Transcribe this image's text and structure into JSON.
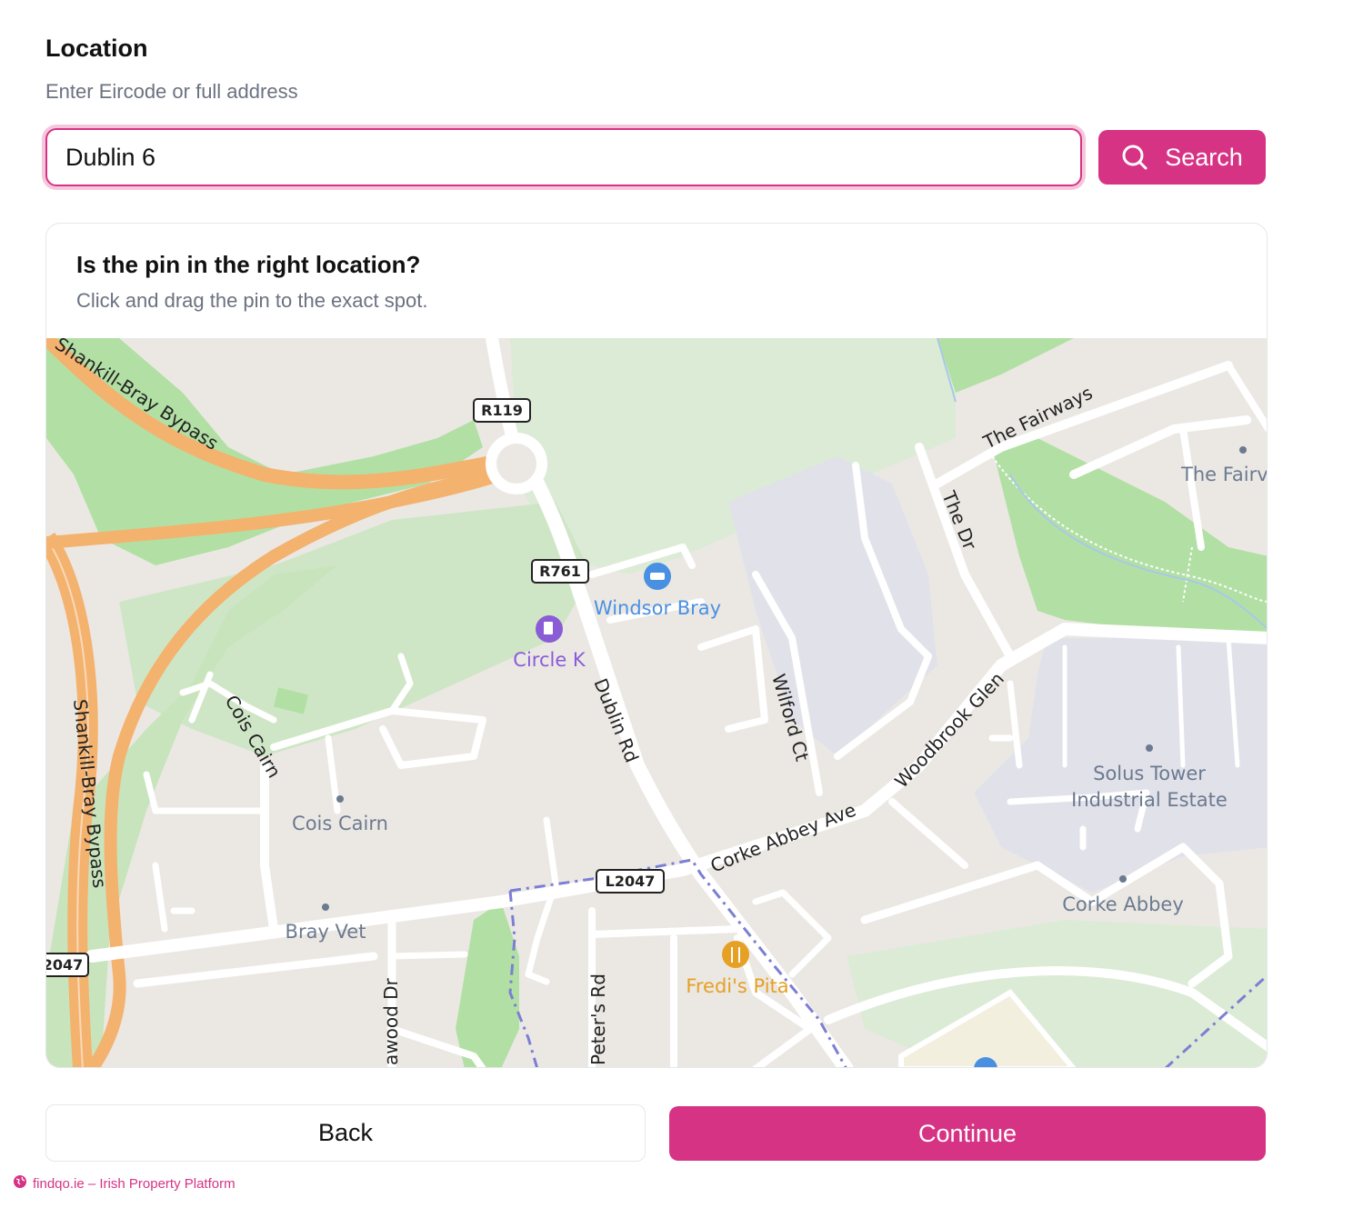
{
  "location": {
    "title": "Location",
    "subtitle": "Enter Eircode or full address",
    "input_value": "Dublin 6",
    "search_label": "Search"
  },
  "map_card": {
    "title": "Is the pin in the right location?",
    "subtitle": "Click and drag the pin to the exact spot."
  },
  "map": {
    "road_labels": {
      "shankill_bray_bypass_top": "Shankill-Bray Bypass",
      "shankill_bray_bypass_left": "Shankill-Bray Bypass",
      "the_fairways": "The Fairways",
      "the_dr": "The Dr",
      "dublin_rd": "Dublin Rd",
      "wilford_ct": "Wilford Ct",
      "woodbrook_glen": "Woodbrook Glen",
      "corke_abbey_ave": "Corke Abbey Ave",
      "cois_cairn_road": "Cois Cairn",
      "seawood_dr": "awood Dr",
      "peters_rd": "Peter's Rd"
    },
    "route_badges": {
      "r119": "R119",
      "r761": "R761",
      "l2047": "L2047",
      "l2047_left": "2047"
    },
    "places": {
      "windsor_bray": "Windsor Bray",
      "circle_k": "Circle K",
      "cois_cairn": "Cois Cairn",
      "bray_vet": "Bray Vet",
      "fredis_pita": "Fredi's Pita",
      "solus_tower_line1": "Solus Tower",
      "solus_tower_line2": "Industrial Estate",
      "corke_abbey": "Corke Abbey",
      "the_fairways_place": "The Fairv"
    },
    "colors": {
      "land": "#ebe8e4",
      "park": "#b2e0a4",
      "park_light": "#dcebd6",
      "motorway": "#f4b26f",
      "industrial": "#e1e1ea",
      "boundary": "#7b7fd4",
      "place_text": "#6b7a8f",
      "poi_blue": "#4a90e2",
      "poi_purple": "#8a5cd6",
      "poi_orange": "#e6a024"
    }
  },
  "actions": {
    "back_label": "Back",
    "continue_label": "Continue"
  },
  "footer": {
    "text": "findqo.ie – Irish Property Platform"
  },
  "theme": {
    "accent": "#d63384"
  }
}
